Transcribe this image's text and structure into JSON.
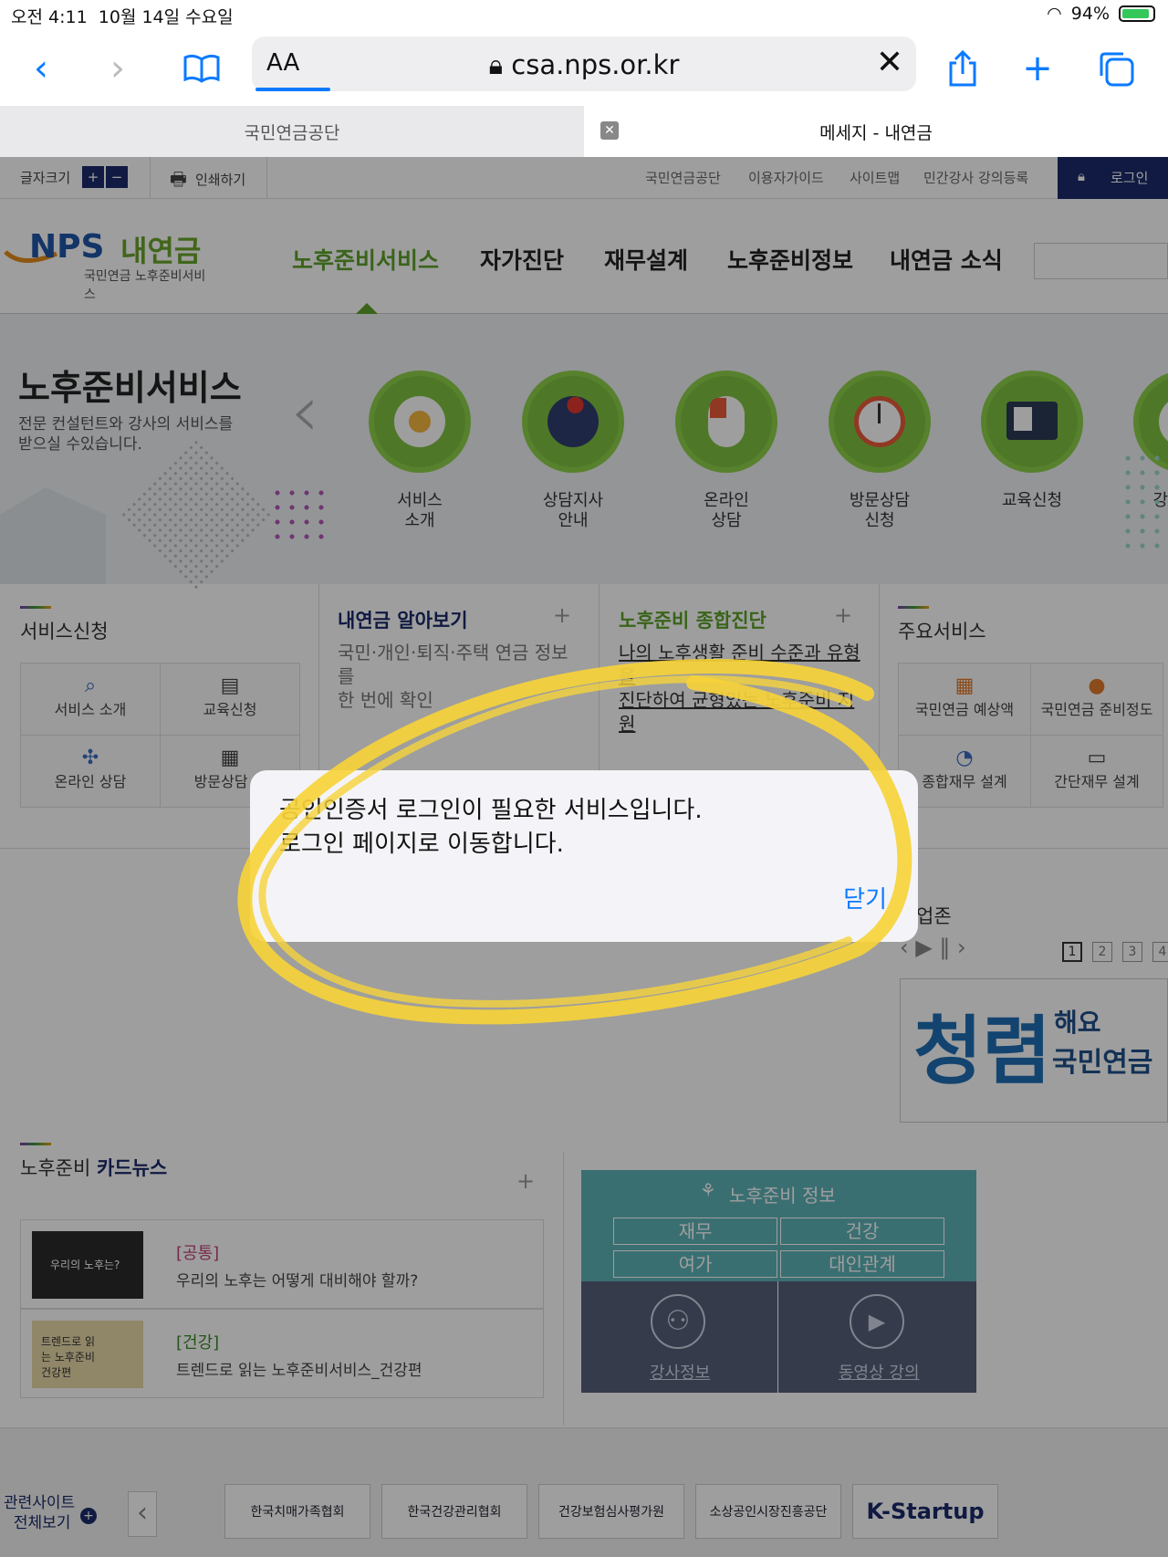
{
  "status": {
    "time": "오전 4:11",
    "date": "10월 14일 수요일",
    "battery": "94%"
  },
  "browser": {
    "text_size": "AA",
    "url": "csa.nps.or.kr",
    "tabs": [
      "국민연금공단",
      "메세지 - 내연금"
    ],
    "icons": [
      "back-icon",
      "forward-icon",
      "bookmarks-icon",
      "share-icon",
      "new-tab-icon",
      "tabs-icon"
    ]
  },
  "util": {
    "font_size": "글자크기",
    "font_plus": "+",
    "font_minus": "−",
    "print": "인쇄하기",
    "links": [
      "국민연금공단",
      "이용자가이드",
      "사이트맵",
      "민간강사 강의등록"
    ],
    "login": "로그인"
  },
  "nav": {
    "logo": "NPS",
    "logo_brand": "내연금",
    "logo_sub": "국민연금 노후준비서비스",
    "items": [
      "노후준비서비스",
      "자가진단",
      "재무설계",
      "노후준비정보",
      "내연금 소식"
    ]
  },
  "hero": {
    "title": "노후준비서비스",
    "desc_line1": "전문 컨설턴트와 강사의 서비스를",
    "desc_line2": "받으실 수있습니다.",
    "services": [
      {
        "l1": "서비스",
        "l2": "소개"
      },
      {
        "l1": "상담지사",
        "l2": "안내"
      },
      {
        "l1": "온라인",
        "l2": "상담"
      },
      {
        "l1": "방문상담",
        "l2": "신청"
      },
      {
        "l1": "교육신청",
        "l2": ""
      },
      {
        "l1": "강",
        "l2": ""
      }
    ]
  },
  "apply": {
    "title": "서비스신청",
    "items": [
      "서비스 소개",
      "교육신청",
      "온라인 상담",
      "방문상담 신"
    ]
  },
  "learn": {
    "title": "내연금 알아보기",
    "line1": "국민·개인·퇴직·주택 연금 정보",
    "line2": "를",
    "line3": "한 번에 확인"
  },
  "diag": {
    "title": "노후준비 종합진단",
    "line1": "나의 노후생활 준비 수준과 유형",
    "line2": "을",
    "line3": "진단하여 균형있는 노후준비 지",
    "line4": "원"
  },
  "main_svc": {
    "title": "주요서비스",
    "items": [
      "국민연금 예상액",
      "국민연금 준비정도",
      "종합재무 설계",
      "간단재무 설계"
    ]
  },
  "promo": {
    "title": "업존",
    "pages": [
      "1",
      "2",
      "3",
      "4"
    ],
    "banner_big": "청렴",
    "banner_small1": "해요",
    "banner_small2": "국민연금"
  },
  "card": {
    "title_pre": "노후준비",
    "title_bold": "카드뉴스",
    "items": [
      {
        "tag": "[공통]",
        "text": "우리의 노후는 어떻게 대비해야 할까?",
        "thumb": "우리의 노후는?"
      },
      {
        "tag": "[건강]",
        "text": "트렌드로 읽는 노후준비서비스_건강편",
        "thumb": "트렌드로 읽는 노후준비 건강편"
      }
    ]
  },
  "info": {
    "title": "노후준비 정보",
    "buttons": [
      "재무",
      "건강",
      "여가",
      "대인관계"
    ],
    "links": [
      "강사정보",
      "동영상 강의"
    ]
  },
  "footer": {
    "related_l1": "관련사이트",
    "related_l2": "전체보기",
    "sites": [
      "한국치매가족협회",
      "한국건강관리협회",
      "건강보험심사평가원",
      "소상공인시장진흥공단",
      "K-Startup"
    ]
  },
  "dialog": {
    "line1": "공인인증서 로그인이 필요한 서비스입니다.",
    "line2": "로그인 페이지로 이동합니다.",
    "close": "닫기"
  },
  "colors": {
    "green": "#7fc241",
    "ios_blue": "#0a7aff",
    "highlight": "#f6d33a",
    "navy": "#1b2a6b"
  }
}
